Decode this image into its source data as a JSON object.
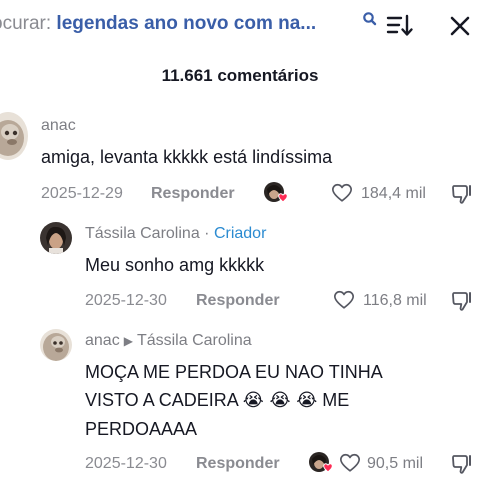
{
  "search": {
    "prefix": "ocurar: ",
    "query": "legendas ano novo com na..."
  },
  "comments_header": {
    "count_label": "11.661 comentários"
  },
  "comments": [
    {
      "username": "anac",
      "text": "amiga, levanta kkkkk está lindíssima",
      "date": "2025-12-29",
      "reply_label": "Responder",
      "likes": "184,4 mil"
    },
    {
      "username": "Tássila Carolina",
      "separator": " · ",
      "badge": "Criador",
      "text": "Meu sonho amg kkkkk",
      "date": "2025-12-30",
      "reply_label": "Responder",
      "likes": "116,8 mil"
    },
    {
      "username": "anac",
      "reply_arrow": "▶",
      "reply_to": "Tássila Carolina",
      "text_line1_a": "MOÇA ME PERDOA EU NAO TINHA",
      "text_line2_a": "VISTO A CADEIRA ",
      "emoji": "😭 😭 😭",
      "text_line2_b": " ME",
      "text_line3": "PERDOAAAA",
      "date": "2025-12-30",
      "reply_label": "Responder",
      "likes": "90,5 mil"
    }
  ],
  "colors": {
    "creator_badge": "#2b8bd1",
    "heart": "#fe2c55"
  }
}
